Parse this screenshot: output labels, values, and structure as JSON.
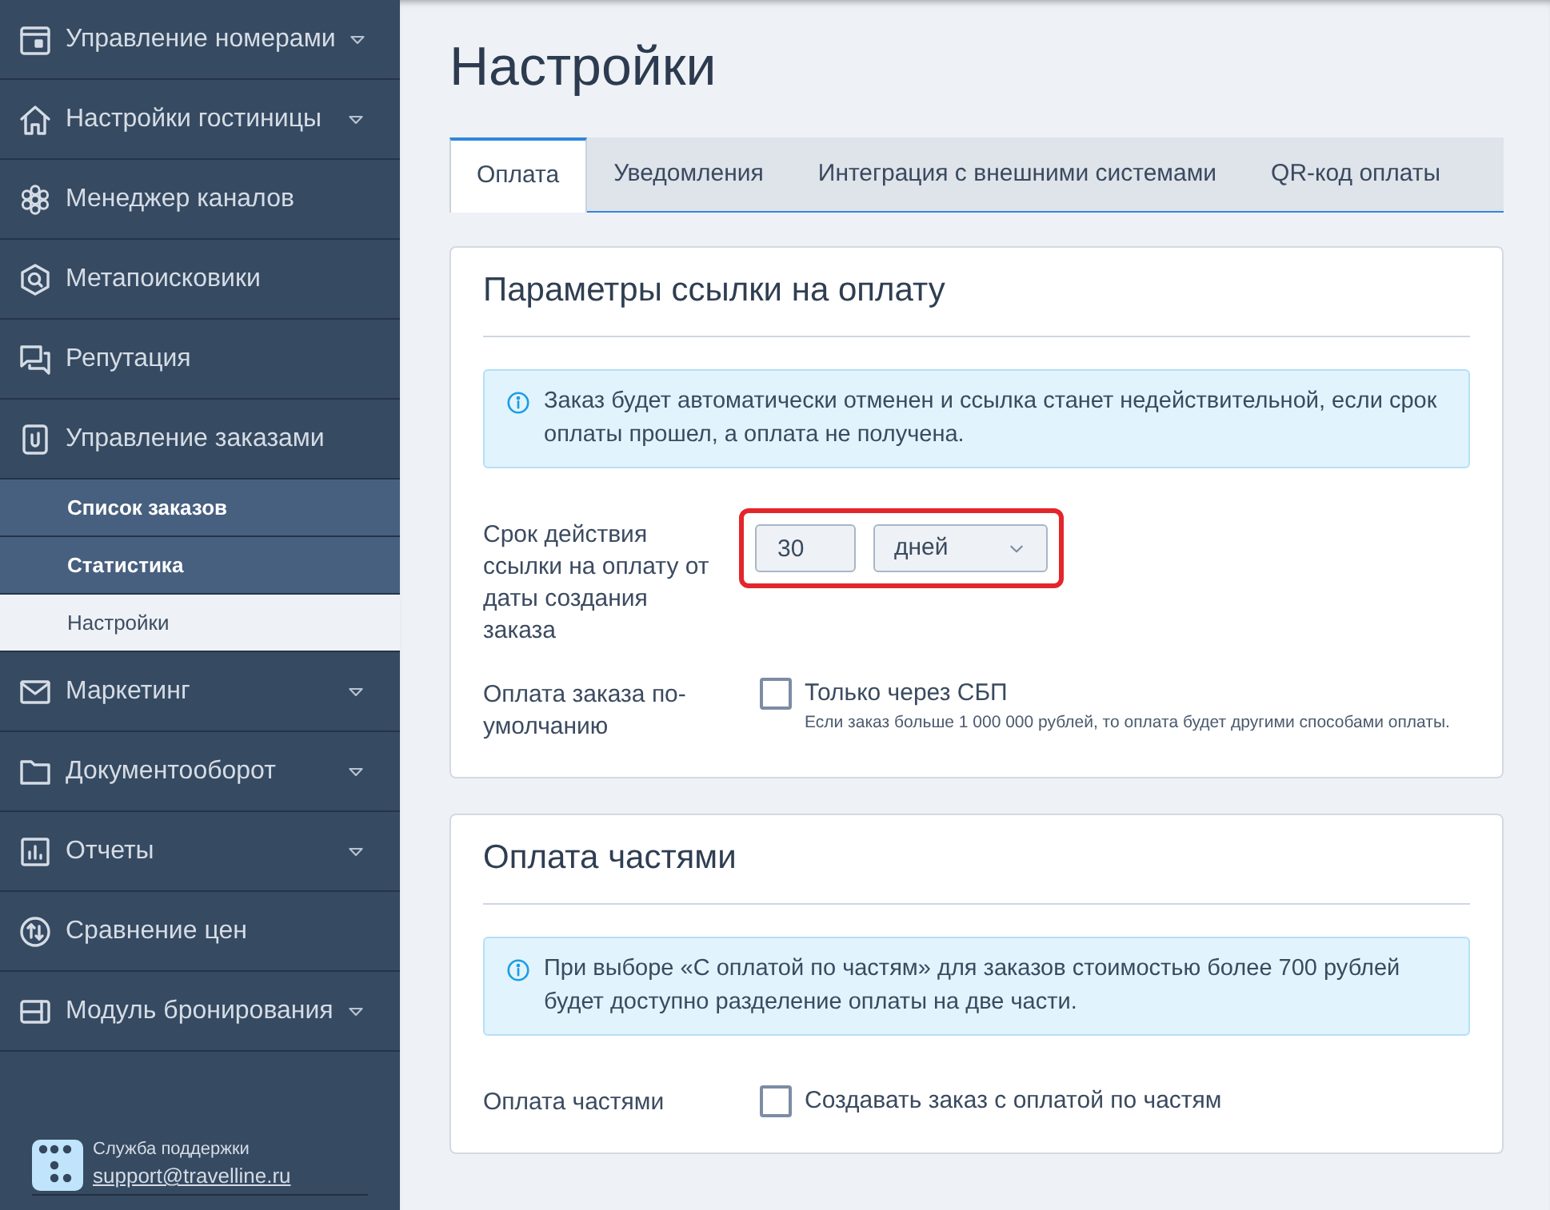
{
  "sidebar": {
    "items": [
      {
        "label": "Управление номерами",
        "expandable": true
      },
      {
        "label": "Настройки гостиницы",
        "expandable": true
      },
      {
        "label": "Менеджер каналов",
        "expandable": false
      },
      {
        "label": "Метапоисковики",
        "expandable": false
      },
      {
        "label": "Репутация",
        "expandable": false
      },
      {
        "label": "Управление заказами",
        "expandable": false,
        "children": [
          {
            "label": "Список заказов",
            "selected": false
          },
          {
            "label": "Статистика",
            "selected": false
          },
          {
            "label": "Настройки",
            "selected": true
          }
        ]
      },
      {
        "label": "Маркетинг",
        "expandable": true
      },
      {
        "label": "Документооборот",
        "expandable": true
      },
      {
        "label": "Отчеты",
        "expandable": true
      },
      {
        "label": "Сравнение цен",
        "expandable": false
      },
      {
        "label": "Модуль бронирования",
        "expandable": true
      }
    ],
    "support": {
      "title": "Служба поддержки",
      "email": "support@travelline.ru"
    }
  },
  "page_title": "Настройки",
  "tabs": [
    {
      "label": "Оплата",
      "selected": true
    },
    {
      "label": "Уведомления",
      "selected": false
    },
    {
      "label": "Интеграция с внешними системами",
      "selected": false
    },
    {
      "label": "QR-код оплаты",
      "selected": false
    }
  ],
  "sections": [
    {
      "title": "Параметры ссылки на оплату",
      "info": "Заказ будет автоматически отменен и ссылка станет недействительной, если срок оплаты прошел, а оплата не получена.",
      "fields": [
        {
          "kind": "duration",
          "label": "Срок действия ссылки на оплату от даты создания заказа",
          "value": "30",
          "unit": "дней",
          "highlighted": true
        },
        {
          "kind": "checkbox",
          "label": "Оплата заказа по-умолчанию",
          "option": "Только через СБП",
          "checked": false,
          "hint": "Если заказ больше 1 000 000 рублей, то оплата будет другими способами оплаты."
        }
      ]
    },
    {
      "title": "Оплата частями",
      "info": "При выборе «С оплатой по частям» для заказов стоимостью более 700 рублей будет доступно разделение оплаты на две части.",
      "fields": [
        {
          "kind": "checkbox",
          "label": "Оплата частями",
          "option": "Создавать заказ с оплатой по частям",
          "checked": false
        }
      ]
    }
  ]
}
